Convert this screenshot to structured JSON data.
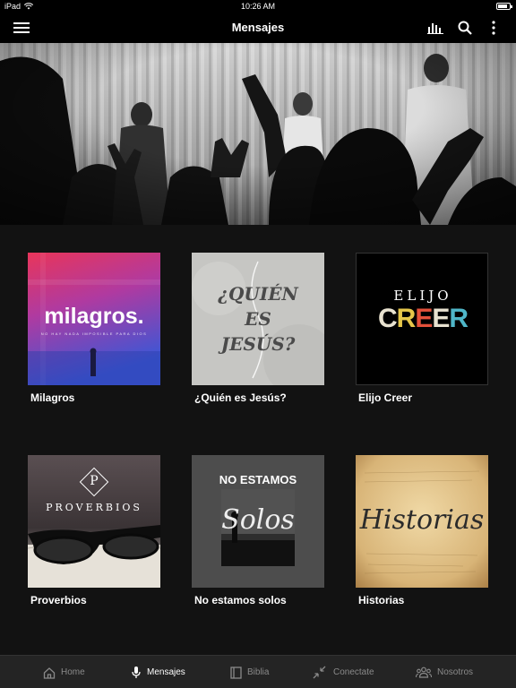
{
  "status_bar": {
    "device": "iPad",
    "time": "10:26 AM",
    "battery_level": 0.85
  },
  "header": {
    "title": "Mensajes",
    "menu_icon": "hamburger-menu-icon",
    "stats_icon": "equalizer-icon",
    "search_icon": "search-icon",
    "more_icon": "more-vertical-icon"
  },
  "grid": {
    "items": [
      {
        "label": "Milagros",
        "art_title": "milagros.",
        "art_subtitle": "NO HAY NADA IMPOSIBLE PARA DIOS"
      },
      {
        "label": "¿Quién es Jesús?",
        "art_line1": "¿QUIÉN",
        "art_line2": "ES",
        "art_line3": "JESÚS?"
      },
      {
        "label": "Elijo Creer",
        "art_line1": "ELIJO",
        "art_line2": "CREER"
      },
      {
        "label": "Proverbios",
        "art_monogram": "P",
        "art_title": "PROVERBIOS"
      },
      {
        "label": "No estamos solos",
        "art_line1": "NO ESTAMOS",
        "art_line2": "Solos"
      },
      {
        "label": "Historias",
        "art_title": "Historias"
      }
    ]
  },
  "tab_bar": {
    "tabs": [
      {
        "label": "Home",
        "icon": "home-icon",
        "active": false
      },
      {
        "label": "Mensajes",
        "icon": "microphone-icon",
        "active": true
      },
      {
        "label": "Biblia",
        "icon": "book-icon",
        "active": false
      },
      {
        "label": "Conectate",
        "icon": "arrows-in-icon",
        "active": false
      },
      {
        "label": "Nosotros",
        "icon": "group-icon",
        "active": false
      }
    ]
  }
}
